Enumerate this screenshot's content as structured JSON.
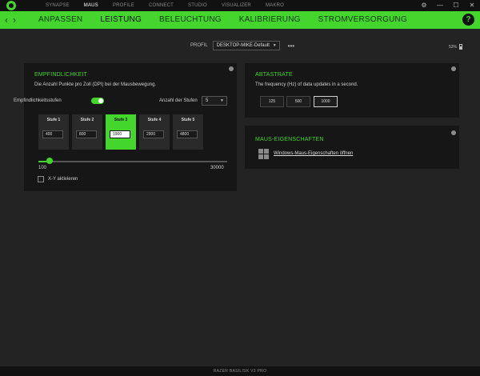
{
  "topnav": {
    "items": [
      "SYNAPSE",
      "MAUS",
      "PROFILE",
      "CONNECT",
      "STUDIO",
      "VISUALIZER",
      "MAKRO"
    ],
    "active_index": 1
  },
  "window_controls": {
    "settings": "⚙",
    "minimize": "—",
    "maximize": "☐",
    "close": "✕"
  },
  "subnav": {
    "back": "‹",
    "forward": "›",
    "items": [
      "ANPASSEN",
      "LEISTUNG",
      "BELEUCHTUNG",
      "KALIBRIERUNG",
      "STROMVERSORGUNG"
    ],
    "active_index": 1,
    "help": "?"
  },
  "profile": {
    "label": "PROFIL",
    "value": "DESKTOP-MIKE-Default",
    "more": "•••"
  },
  "battery": {
    "percent": "53%",
    "level": 0.53
  },
  "sensitivity": {
    "title": "EMPFINDLICHKEIT",
    "description": "Die Anzahl Punkte pro Zoll (DPI) bei der Mausbewegung.",
    "toggle_label": "Empfindlichkeitsstufen",
    "toggle_on": true,
    "stages_count_label": "Anzahl der Stufen",
    "stages_count_value": "5",
    "stages": [
      {
        "label": "Stufe 1",
        "value": "400"
      },
      {
        "label": "Stufe 2",
        "value": "800"
      },
      {
        "label": "Stufe 3",
        "value": "1900"
      },
      {
        "label": "Stufe 4",
        "value": "2900"
      },
      {
        "label": "Stufe 5",
        "value": "4800"
      }
    ],
    "active_stage": 2,
    "slider_min": "100",
    "slider_max": "30000",
    "slider_value": 1900,
    "xy_label": "X-Y aktivieren",
    "xy_checked": false
  },
  "polling": {
    "title": "ABTASTRATE",
    "description": "The frequency (Hz) of data updates in a second.",
    "options": [
      "125",
      "500",
      "1000"
    ],
    "active_index": 2
  },
  "mouse_props": {
    "title": "MAUS-EIGENSCHAFTEN",
    "link": "Windows-Maus-Eigenschaften öffnen"
  },
  "footer": {
    "device": "RAZER BASILISK V3 PRO"
  },
  "colors": {
    "accent": "#44d62c",
    "panel": "#161616",
    "background": "#232323"
  }
}
